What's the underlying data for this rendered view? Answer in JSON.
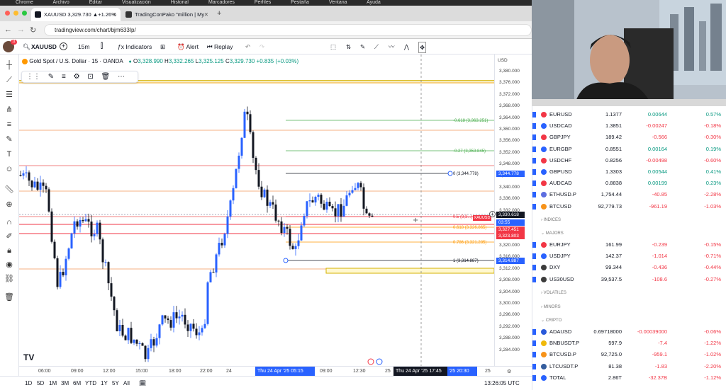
{
  "os_menu": [
    "Chrome",
    "Archivo",
    "Editar",
    "Visualización",
    "Historial",
    "Marcadores",
    "Perfiles",
    "Pestaña",
    "Ventana",
    "Ayuda"
  ],
  "browser": {
    "tabs": [
      {
        "title": "XAUUSD 3,329.730 ▲+1.26%",
        "active": true
      },
      {
        "title": "TradingConPako \"million | My",
        "active": false
      }
    ],
    "new_tab": "+",
    "url": "tradingview.com/chart/bjm633Ip/"
  },
  "toolbar": {
    "symbol": "XAUUSD",
    "add_symbol": "+",
    "interval": "15m",
    "indicators": "Indicators",
    "alert": "Alert",
    "replay": "Replay"
  },
  "legend": {
    "title": "Gold Spot / U.S. Dollar · 15 · OANDA",
    "o_label": "O",
    "o": "3,328.990",
    "h_label": "H",
    "h": "3,332.265",
    "l_label": "L",
    "l": "3,325.125",
    "c_label": "C",
    "c": "3,329.730",
    "change": "+0.835 (+0.03%)"
  },
  "currency": "USD",
  "y_ticks": [
    "3,380.000",
    "3,376.000",
    "3,372.000",
    "3,368.000",
    "3,364.000",
    "3,360.000",
    "3,356.000",
    "3,352.000",
    "3,348.000",
    "3,344.000",
    "3,340.000",
    "3,336.000",
    "3,332.000",
    "3,328.000",
    "3,324.000",
    "3,320.000",
    "3,316.000",
    "3,312.000",
    "3,308.000",
    "3,304.000",
    "3,300.000",
    "3,296.000",
    "3,292.000",
    "3,288.000",
    "3,284.000"
  ],
  "price_labels": [
    {
      "text": "3,344.778",
      "color": "#2962ff"
    },
    {
      "text": "3,330.618",
      "color": "#131722"
    },
    {
      "text": "XAUUSD",
      "color": "#f23645"
    },
    {
      "text": "03:55",
      "color": "#2962ff"
    },
    {
      "text": "3,327.451",
      "color": "#f23645"
    },
    {
      "text": "3,323.803",
      "color": "#f23645"
    },
    {
      "text": "3,314.887",
      "color": "#2962ff"
    }
  ],
  "fib_labels": [
    {
      "text": "-0.618 (3,363.251)",
      "color": "#4caf50"
    },
    {
      "text": "-0.27 (3,353.845)",
      "color": "#4caf50"
    },
    {
      "text": "0 (3,344.778)",
      "color": "#131722"
    },
    {
      "text": "0.5 (3,3...)",
      "color": "#f23645"
    },
    {
      "text": "0.618 (3,326.865)",
      "color": "#ff9800"
    },
    {
      "text": "0.786 (3,321.285)",
      "color": "#ff9800"
    },
    {
      "text": "1 (3,314.887)",
      "color": "#131722"
    }
  ],
  "x_ticks": [
    "06:00",
    "09:00",
    "12:00",
    "15:00",
    "18:00",
    "22:00",
    "24",
    "09:00",
    "12:30",
    "25",
    "25"
  ],
  "x_highlights": [
    "Thu 24 Apr '25  05:15",
    "Thu 24 Apr '25  17:45"
  ],
  "x_highlight_tail": "'25  20:30",
  "timeframes": [
    "1D",
    "5D",
    "1M",
    "3M",
    "6M",
    "YTD",
    "1Y",
    "5Y",
    "All"
  ],
  "clock": "13:26:05 UTC",
  "watchlist": {
    "rows_top": [
      {
        "sym": "EURUSD",
        "last": "1.1377",
        "chg": "0.00644",
        "pct": "0.57%",
        "dir": "up"
      },
      {
        "sym": "USDCAD",
        "last": "1.3851",
        "chg": "-0.00247",
        "pct": "-0.18%",
        "dir": "down"
      },
      {
        "sym": "GBPJPY",
        "last": "189.42",
        "chg": "-0.566",
        "pct": "-0.30%",
        "dir": "down"
      },
      {
        "sym": "EURGBP",
        "last": "0.8551",
        "chg": "0.00164",
        "pct": "0.19%",
        "dir": "up"
      },
      {
        "sym": "USDCHF",
        "last": "0.8256",
        "chg": "-0.00498",
        "pct": "-0.60%",
        "dir": "down"
      },
      {
        "sym": "GBPUSD",
        "last": "1.3303",
        "chg": "0.00544",
        "pct": "0.41%",
        "dir": "up"
      },
      {
        "sym": "AUDCAD",
        "last": "0.8838",
        "chg": "0.00199",
        "pct": "0.23%",
        "dir": "up"
      },
      {
        "sym": "ETHUSD.P",
        "last": "1,754.44",
        "chg": "-40.85",
        "pct": "-2.28%",
        "dir": "down"
      },
      {
        "sym": "BTCUSD",
        "last": "92,779.73",
        "chg": "-961.19",
        "pct": "-1.03%",
        "dir": "down"
      }
    ],
    "section_indices": "INDICES",
    "section_majors": "MAJORS",
    "rows_majors": [
      {
        "sym": "EURJPY",
        "last": "161.99",
        "chg": "-0.239",
        "pct": "-0.15%",
        "dir": "down"
      },
      {
        "sym": "USDJPY",
        "last": "142.37",
        "chg": "-1.014",
        "pct": "-0.71%",
        "dir": "down"
      },
      {
        "sym": "DXY",
        "last": "99.344",
        "chg": "-0.436",
        "pct": "-0.44%",
        "dir": "down"
      },
      {
        "sym": "US30USD",
        "last": "39,537.5",
        "chg": "-108.6",
        "pct": "-0.27%",
        "dir": "down"
      }
    ],
    "section_volatiles": "VOLATILES",
    "section_minors": "MINORS",
    "section_cripto": "CRIPTO",
    "rows_cripto": [
      {
        "sym": "ADAUSD",
        "last": "0.69718000",
        "chg": "-0.00039000",
        "pct": "-0.06%",
        "dir": "down"
      },
      {
        "sym": "BNBUSDT.P",
        "last": "597.9",
        "chg": "-7.4",
        "pct": "-1.22%",
        "dir": "down"
      },
      {
        "sym": "BTCUSD.P",
        "last": "92,725.0",
        "chg": "-959.1",
        "pct": "-1.02%",
        "dir": "down"
      },
      {
        "sym": "LTCUSDT.P",
        "last": "81.38",
        "chg": "-1.83",
        "pct": "-2.20%",
        "dir": "down"
      },
      {
        "sym": "TOTAL",
        "last": "2.86T",
        "chg": "-32.37B",
        "pct": "-1.12%",
        "dir": "down"
      }
    ]
  },
  "colors": {
    "up": "#2962ff",
    "down": "#131722",
    "green": "#089981",
    "red": "#f23645",
    "accent": "#2962ff"
  }
}
